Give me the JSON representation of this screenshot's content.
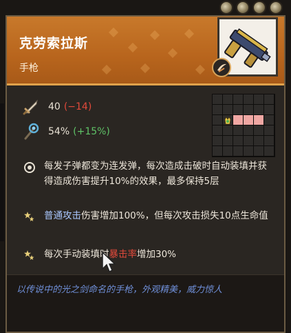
{
  "header": {
    "title": "克劳索拉斯",
    "weapon_type": "手枪"
  },
  "coins": [
    "coin",
    "coin",
    "coin",
    "coin"
  ],
  "stats": {
    "attack": {
      "value": "40",
      "delta": "(−14)"
    },
    "crit": {
      "value": "54%",
      "delta": "(+15%)"
    }
  },
  "grid": {
    "rows": 6,
    "cols": 6,
    "start_cell": [
      2,
      1
    ],
    "filled_cells": [
      [
        2,
        2
      ],
      [
        2,
        3
      ],
      [
        2,
        4
      ]
    ]
  },
  "effects": {
    "main": "每发子弹都变为连发弹，每次造成击破时自动装填并获得造成伤害提升10%的效果，最多保持5层",
    "bonus1_highlight": "普通攻击",
    "bonus1_rest": "伤害增加100%，但每次攻击损失10点生命值",
    "bonus2_pre": "每次手动装填时",
    "bonus2_highlight": "暴击率",
    "bonus2_post": "增加30%"
  },
  "flavor_text": "以传说中的光之剑命名的手枪，外观精美，威力惊人",
  "icons": {
    "attack": "sword-icon",
    "crit": "crit-staff-icon",
    "main_bullet": "target-ring-icon",
    "bonus_bullet": "double-star-icon",
    "weapon": "pistol-icon",
    "badge": "slash-badge-icon",
    "grid_start": "character-marker-icon"
  },
  "colors": {
    "header": "#c8792b",
    "negative": "#e24a3b",
    "positive": "#5fc267",
    "highlight_blue": "#aac8ff",
    "highlight_red": "#e24a3b",
    "flavor": "#6f8fd8",
    "grid_filled": "#f0a7a3"
  }
}
